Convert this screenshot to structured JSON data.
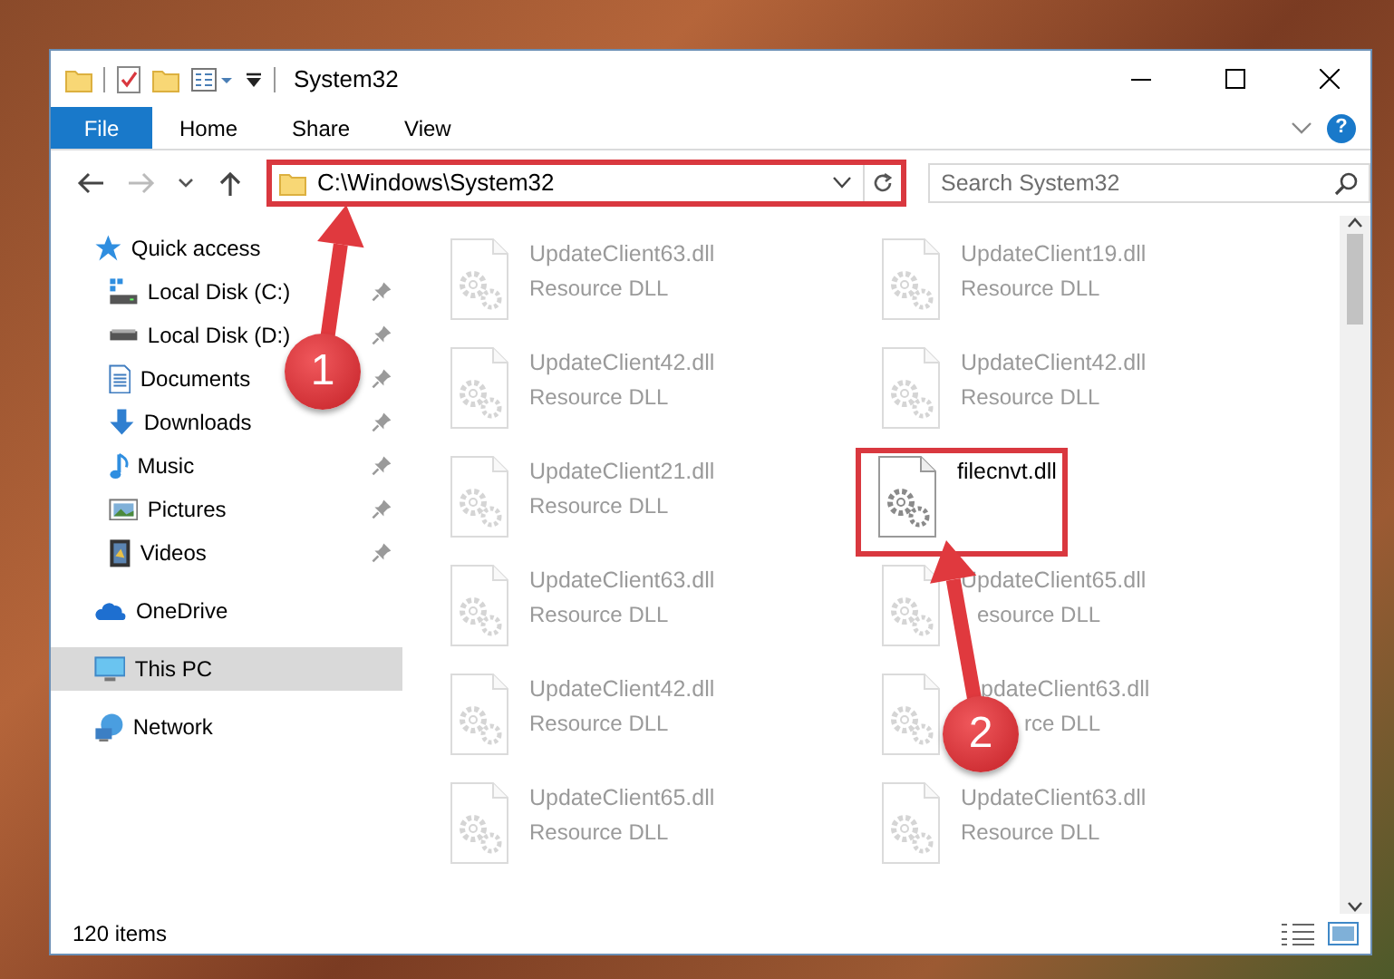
{
  "window": {
    "title": "System32"
  },
  "ribbon_tabs": [
    {
      "label": "File",
      "kind": "file"
    },
    {
      "label": "Home",
      "kind": "tab"
    },
    {
      "label": "Share",
      "kind": "tab"
    },
    {
      "label": "View",
      "kind": "tab"
    }
  ],
  "help_glyph": "?",
  "address_bar": {
    "path": "C:\\Windows\\System32",
    "highlighted": true
  },
  "search": {
    "placeholder": "Search System32"
  },
  "sidebar": {
    "items": [
      {
        "label": "Quick access",
        "kind": "star",
        "selected": false,
        "children": [
          {
            "label": "Local Disk (C:)",
            "kind": "system-drive",
            "pinned": true
          },
          {
            "label": "Local Disk (D:)",
            "kind": "drive",
            "pinned": true
          },
          {
            "label": "Documents",
            "kind": "documents",
            "pinned": true
          },
          {
            "label": "Downloads",
            "kind": "downloads",
            "pinned": true
          },
          {
            "label": "Music",
            "kind": "music",
            "pinned": true
          },
          {
            "label": "Pictures",
            "kind": "pictures",
            "pinned": true
          },
          {
            "label": "Videos",
            "kind": "videos",
            "pinned": true
          }
        ]
      },
      {
        "label": "OneDrive",
        "kind": "cloud",
        "selected": false
      },
      {
        "label": "This PC",
        "kind": "computer",
        "selected": true
      },
      {
        "label": "Network",
        "kind": "network",
        "selected": false
      }
    ]
  },
  "files": [
    {
      "name": "UpdateClient63.dll",
      "type": "Resource DLL",
      "faded": true,
      "highlighted": false
    },
    {
      "name": "UpdateClient19.dll",
      "type": "Resource DLL",
      "faded": true,
      "highlighted": false
    },
    {
      "name": "UpdateClient42.dll",
      "type": "Resource DLL",
      "faded": true,
      "highlighted": false
    },
    {
      "name": "UpdateClient42.dll",
      "type": "Resource DLL",
      "faded": true,
      "highlighted": false
    },
    {
      "name": "UpdateClient21.dll",
      "type": "Resource DLL",
      "faded": true,
      "highlighted": false
    },
    {
      "name": "filecnvt.dll",
      "faded": false,
      "highlighted": true
    },
    {
      "name": "UpdateClient63.dll",
      "type": "Resource DLL",
      "faded": true,
      "highlighted": false
    },
    {
      "name": "UpdateClient65.dll",
      "type": "esource DLL",
      "faded": true,
      "highlighted": false,
      "type_covered": true
    },
    {
      "name": "UpdateClient42.dll",
      "type": "Resource DLL",
      "faded": true,
      "highlighted": false
    },
    {
      "name": "pdateClient63.dll",
      "type": "rce DLL",
      "faded": true,
      "highlighted": false,
      "name_covered": true,
      "type_covered": true
    },
    {
      "name": "UpdateClient65.dll",
      "type": "Resource DLL",
      "faded": true,
      "highlighted": false
    },
    {
      "name": "UpdateClient63.dll",
      "type": "Resource DLL",
      "faded": true,
      "highlighted": false
    }
  ],
  "status_bar": {
    "item_count": "120 items"
  },
  "annotations": [
    {
      "label": "1"
    },
    {
      "label": "2"
    }
  ]
}
